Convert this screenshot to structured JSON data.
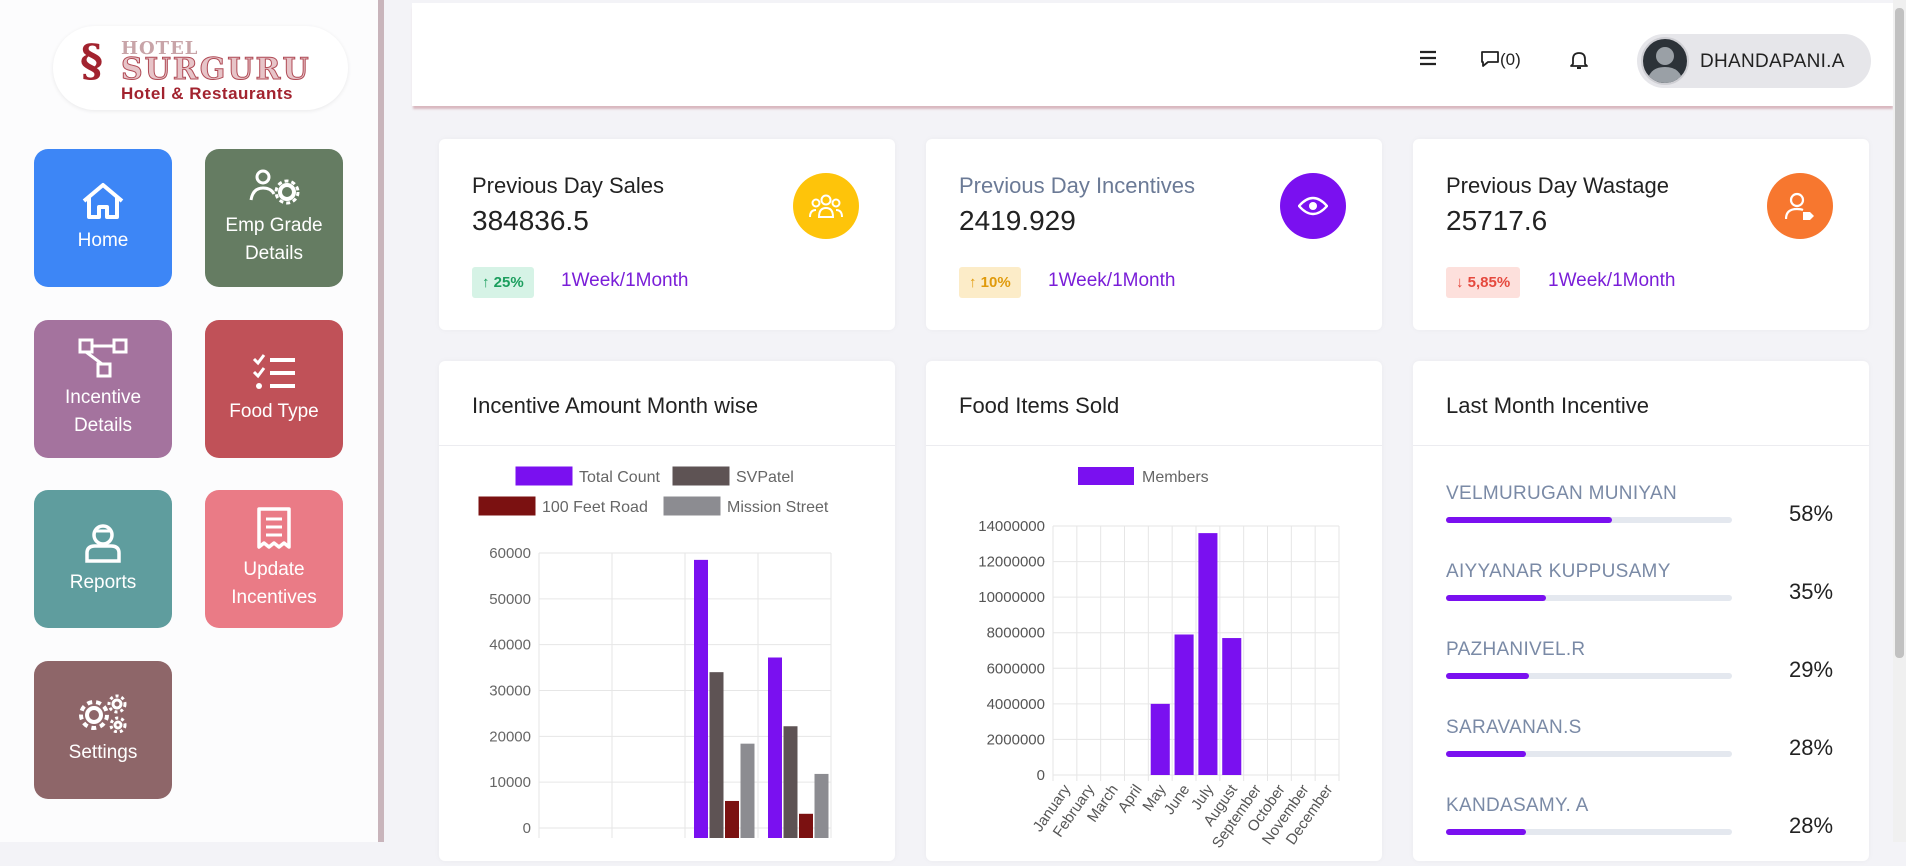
{
  "brand": {
    "line1": "HOTEL",
    "line2": "SURGURU",
    "line3": "Hotel & Restaurants"
  },
  "tiles": [
    {
      "label": "Home",
      "color": "#3d86f6"
    },
    {
      "label": "Emp Grade Details",
      "color": "#657c62"
    },
    {
      "label": "Incentive Details",
      "color": "#a4739e"
    },
    {
      "label": "Food Type",
      "color": "#c05158"
    },
    {
      "label": "Reports",
      "color": "#5f9d9e"
    },
    {
      "label": "Update Incentives",
      "color": "#ea7b86"
    },
    {
      "label": "Settings",
      "color": "#8e6669"
    }
  ],
  "header": {
    "chat_count": "(0)",
    "user_name": "DHANDAPANI.A"
  },
  "stats": [
    {
      "title": "Previous Day Sales",
      "value": "384836.5",
      "badge": "25%",
      "trend": "up",
      "range_a": "1Week",
      "range_sep": "/",
      "range_b": "1Month",
      "icon": "users-icon",
      "icon_color": "#fec40a"
    },
    {
      "title": "Previous Day Incentives",
      "value": "2419.929",
      "badge": "10%",
      "trend": "up",
      "range_a": "1Week",
      "range_sep": "/",
      "range_b": "1Month",
      "icon": "eye-icon",
      "icon_color": "#7a10f0"
    },
    {
      "title": "Previous Day Wastage",
      "value": "25717.6",
      "badge": "5,85%",
      "trend": "down",
      "range_a": "1Week",
      "range_sep": "/",
      "range_b": "1Month",
      "icon": "user-tag-icon",
      "icon_color": "#f7772f"
    }
  ],
  "panels": {
    "incentive_month": "Incentive Amount Month wise",
    "food_sold": "Food Items Sold",
    "last_month": "Last Month Incentive"
  },
  "last_month_incentive": [
    {
      "name": "VELMURUGAN MUNIYAN",
      "pct": "58%",
      "value": 58
    },
    {
      "name": "AIYYANAR KUPPUSAMY",
      "pct": "35%",
      "value": 35
    },
    {
      "name": "PAZHANIVEL.R",
      "pct": "29%",
      "value": 29
    },
    {
      "name": "SARAVANAN.S",
      "pct": "28%",
      "value": 28
    },
    {
      "name": "KANDASAMY. A",
      "pct": "28%",
      "value": 28
    }
  ],
  "chart_data": [
    {
      "type": "bar",
      "series": [
        {
          "name": "Total Count",
          "color": "#7a10f0",
          "values": [
            0,
            0,
            58500,
            37200
          ]
        },
        {
          "name": "SVPatel",
          "color": "#5e5354",
          "values": [
            0,
            0,
            34000,
            22200
          ]
        },
        {
          "name": "100 Feet Road",
          "color": "#7b1111",
          "values": [
            0,
            0,
            5900,
            3100
          ]
        },
        {
          "name": "Mission Street",
          "color": "#8c8c91",
          "values": [
            0,
            0,
            18400,
            11800
          ]
        }
      ],
      "ylim": [
        0,
        60000
      ],
      "yticks": [
        "60000",
        "50000",
        "40000",
        "30000",
        "20000",
        "10000",
        "0"
      ],
      "grid": true,
      "legend": "top"
    },
    {
      "type": "bar",
      "categories": [
        "January",
        "February",
        "March",
        "April",
        "May",
        "June",
        "July",
        "August",
        "September",
        "October",
        "November",
        "December"
      ],
      "series": [
        {
          "name": "Members",
          "color": "#7a10f0",
          "values": [
            0,
            0,
            0,
            0,
            4000000,
            7900000,
            13600000,
            7700000,
            0,
            0,
            0,
            0
          ]
        }
      ],
      "ylim": [
        0,
        14000000
      ],
      "yticks": [
        "14000000",
        "12000000",
        "10000000",
        "8000000",
        "6000000",
        "4000000",
        "2000000",
        "0"
      ],
      "grid": true,
      "legend": "top"
    }
  ]
}
